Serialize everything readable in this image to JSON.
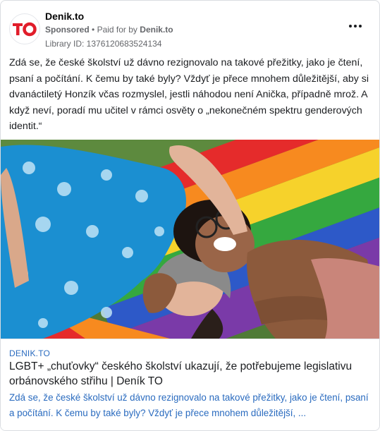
{
  "post": {
    "page_name": "Denik.to",
    "sponsored": "Sponsored",
    "separator": "•",
    "paid_for_prefix": "Paid for by",
    "paid_for_by": "Denik.to",
    "library_id": "Library ID: 1376120683524134",
    "avatar_logo": "TO",
    "brand_color": "#e11d2a",
    "more_icon": "more-horizontal-icon",
    "body": "Zdá se, že české školství už dávno rezignovalo na takové přežitky, jako je čtení, psaní a počítání. K čemu by také byly? Vždyť je přece mnohem důležitější, aby si dvanáctiletý Honzík včas rozmyslel, jestli náhodou není Anička, případně mrož. A když neví, poradí mu učitel v rámci osvěty o „nekonečném spektru genderových identit.“"
  },
  "link_preview": {
    "domain": "DENIK.TO",
    "title": "LGBT+ „chuťovky“ českého školství ukazují, že potřebujeme legislativu orbánovského střihu | Deník TO",
    "description": "Zdá se, že české školství už dávno rezignovalo na takové přežitky, jako je čtení, psaní a počítání. K čemu by také byly? Vždyť je přece mnohem důležitější, ...",
    "link_color": "#2a6bbf"
  }
}
